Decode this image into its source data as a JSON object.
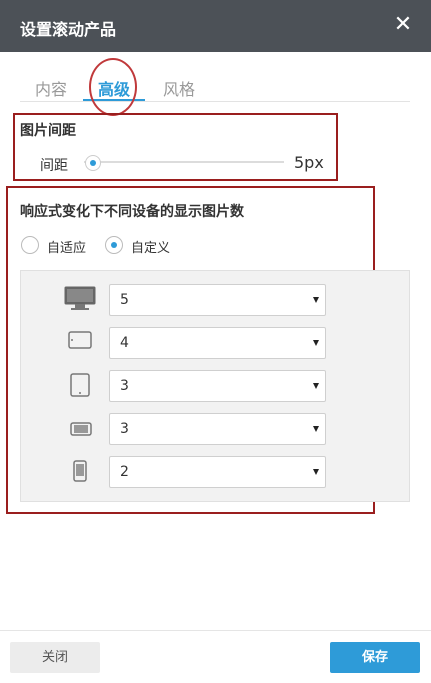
{
  "dialog": {
    "title": "设置滚动产品",
    "close_glyph": "✕"
  },
  "tabs": [
    {
      "label": "内容",
      "active": false
    },
    {
      "label": "高级",
      "active": true
    },
    {
      "label": "风格",
      "active": false
    }
  ],
  "spacing": {
    "section_title": "图片间距",
    "label": "间距",
    "value_text": "5px",
    "value": 5
  },
  "responsive": {
    "section_title": "响应式变化下不同设备的显示图片数",
    "options": [
      {
        "label": "自适应",
        "checked": false
      },
      {
        "label": "自定义",
        "checked": true
      }
    ],
    "devices": [
      {
        "icon": "desktop-icon",
        "value": "5"
      },
      {
        "icon": "tablet-landscape-icon",
        "value": "4"
      },
      {
        "icon": "tablet-portrait-icon",
        "value": "3"
      },
      {
        "icon": "phone-landscape-icon",
        "value": "3"
      },
      {
        "icon": "phone-portrait-icon",
        "value": "2"
      }
    ]
  },
  "footer": {
    "close_label": "关闭",
    "save_label": "保存"
  },
  "colors": {
    "accent": "#2e9bd8",
    "titlebar": "#4c5157",
    "annotation": "#9a1e1e"
  }
}
